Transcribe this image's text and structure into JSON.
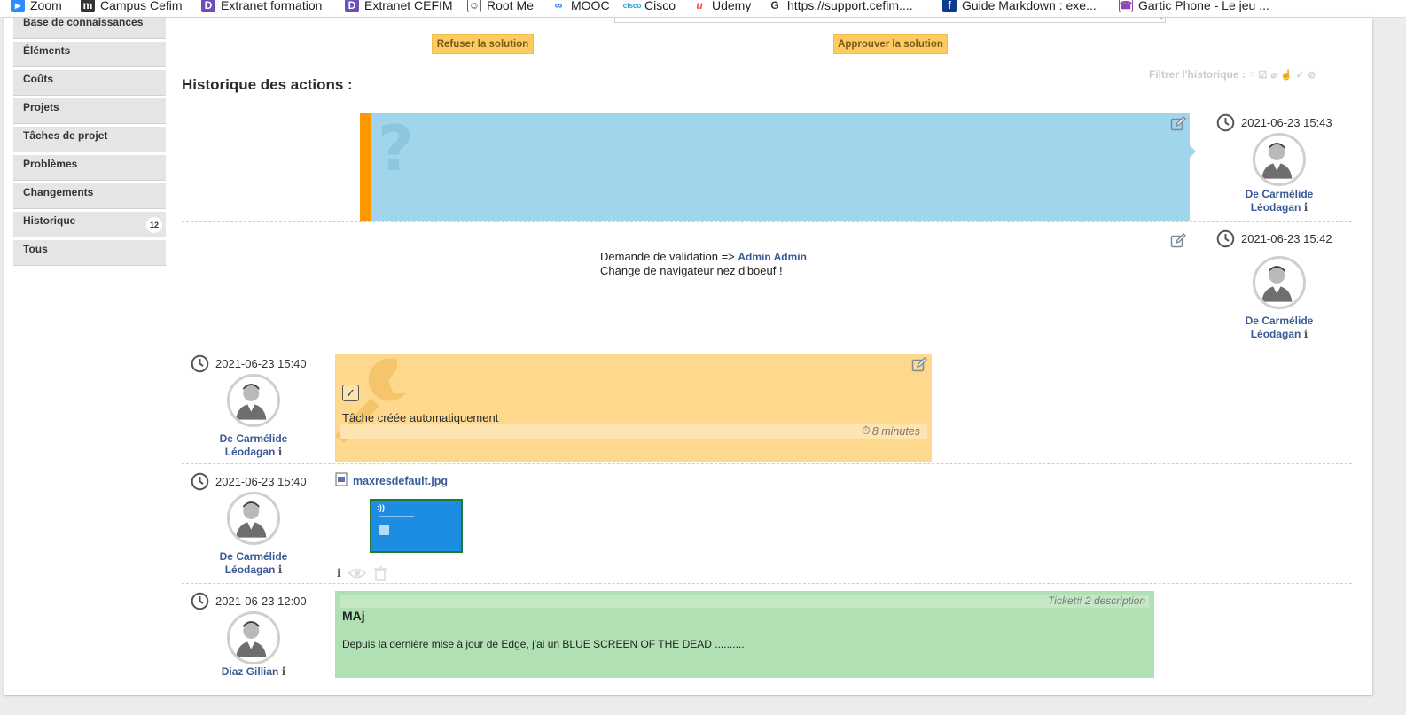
{
  "bookmarks": [
    {
      "label": "Zoom",
      "icon": "zoom-icon",
      "color": "#2d8cff"
    },
    {
      "label": "Campus Cefim",
      "icon": "moodle-icon",
      "color": "#333333"
    },
    {
      "label": "Extranet formation",
      "icon": "extranet-icon",
      "color": "#6b4fbb"
    },
    {
      "label": "Extranet CEFIM",
      "icon": "extranet-icon",
      "color": "#6b4fbb"
    },
    {
      "label": "Root Me",
      "icon": "rootme-icon",
      "color": "#444444"
    },
    {
      "label": "MOOC",
      "icon": "mooc-icon",
      "color": "#1a73e8"
    },
    {
      "label": "Cisco",
      "icon": "cisco-icon",
      "color": "#1ba0d7"
    },
    {
      "label": "Udemy",
      "icon": "udemy-icon",
      "color": "#ec5252"
    },
    {
      "label": "https://support.cefim....",
      "icon": "globe-icon",
      "color": "#333333"
    },
    {
      "label": "Guide Markdown : exe...",
      "icon": "bookmark-icon",
      "color": "#0b3c8c"
    },
    {
      "label": "Gartic Phone - Le jeu ...",
      "icon": "gartic-icon",
      "color": "#8e44ad"
    }
  ],
  "sidebar": {
    "items": [
      {
        "label": "Base de connaissances"
      },
      {
        "label": "Éléments"
      },
      {
        "label": "Coûts"
      },
      {
        "label": "Projets"
      },
      {
        "label": "Tâches de projet"
      },
      {
        "label": "Problèmes"
      },
      {
        "label": "Changements"
      },
      {
        "label": "Historique",
        "badge": "12"
      },
      {
        "label": "Tous"
      }
    ]
  },
  "actions": {
    "refuse": "Refuser la solution",
    "approve": "Approuver la solution"
  },
  "history": {
    "title": "Historique des actions :",
    "filter_label": "Filtrer l'historique :"
  },
  "timeline": [
    {
      "date": "2021-06-23 15:43",
      "author": "De Carmélide Léodagan",
      "author_line1": "De Carmélide",
      "author_line2": "Léodagan"
    },
    {
      "date": "2021-06-23 15:42",
      "author_line1": "De Carmélide",
      "author_line2": "Léodagan",
      "line1_prefix": "Demande de validation => ",
      "validator": "Admin Admin",
      "line2": "Change de navigateur nez d'boeuf !"
    },
    {
      "date": "2021-06-23 15:40",
      "author_line1": "De Carmélide",
      "author_line2": "Léodagan",
      "task_text": "Tâche créée automatiquement",
      "duration": "8 minutes"
    },
    {
      "date": "2021-06-23 15:40",
      "author_line1": "De Carmélide",
      "author_line2": "Léodagan",
      "filename": "maxresdefault.jpg",
      "thumb_text": ":))"
    },
    {
      "date": "2021-06-23 12:00",
      "author_line1": "Diaz Gillian",
      "author_line2": "",
      "header": "Ticket# 2 description",
      "title": "MAj",
      "body": "Depuis la dernière mise à jour de Edge, j'ai un BLUE SCREEN OF THE DEAD .........."
    }
  ]
}
